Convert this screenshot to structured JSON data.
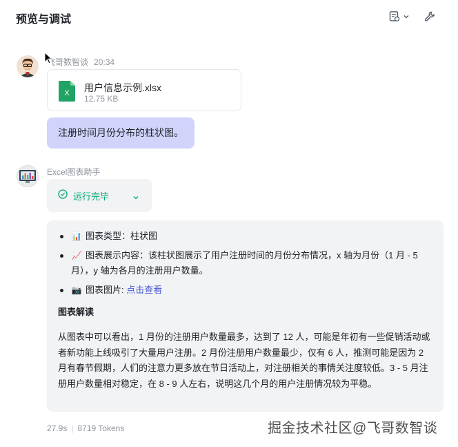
{
  "header": {
    "title": "预览与调试",
    "chat_settings_icon": "chat-settings-icon",
    "wrench_icon": "wrench-icon"
  },
  "user_message": {
    "sender": "飞哥数智谈",
    "time": "20:34",
    "file": {
      "name": "用户信息示例.xlsx",
      "size": "12.75 KB",
      "icon": "excel-file-icon"
    },
    "text": "注册时间月份分布的柱状图。"
  },
  "bot_message": {
    "sender": "Excel图表助手",
    "status": "运行完毕",
    "status_icon": "check-circle-icon",
    "bullets": [
      {
        "emoji": "📊",
        "text": "图表类型：柱状图"
      },
      {
        "emoji": "📈",
        "text": "图表展示内容：该柱状图展示了用户注册时间的月份分布情况，x 轴为月份（1 月 - 5 月），y 轴为各月的注册用户数量。"
      },
      {
        "emoji": "📷",
        "prefix": "图表图片: ",
        "link": "点击查看"
      }
    ],
    "section_title": "图表解读",
    "paragraph": "从图表中可以看出，1 月份的注册用户数量最多，达到了 12 人，可能是年初有一些促销活动或者新功能上线吸引了大量用户注册。2 月份注册用户数量最少，仅有 6 人，推测可能是因为 2 月有春节假期，人们的注意力更多放在节日活动上，对注册相关的事情关注度较低。3 - 5 月注册用户数量相对稳定，在 8 - 9 人左右，说明这几个月的用户注册情况较为平稳。",
    "duration": "27.9s",
    "tokens": "8719 Tokens"
  },
  "watermark": "掘金技术社区@飞哥数智谈",
  "colors": {
    "accent": "#4c5bd4",
    "user_bubble": "#d1d3fa",
    "success": "#00a870",
    "excel_green": "#21a366"
  }
}
